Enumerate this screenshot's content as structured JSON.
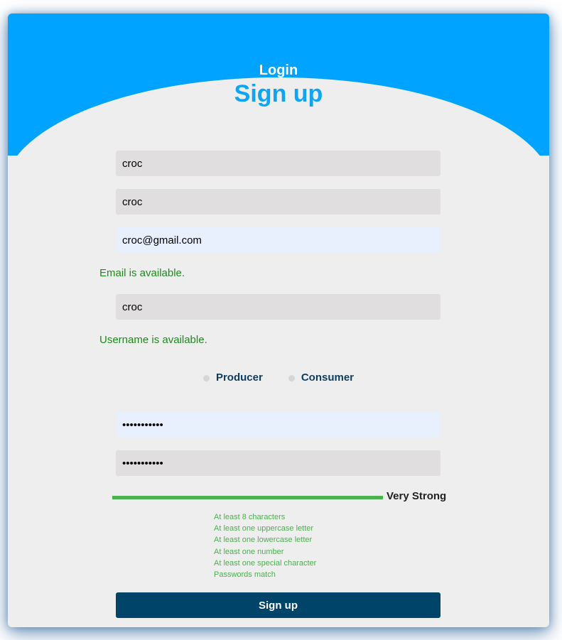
{
  "header": {
    "login_label": "Login",
    "title": "Sign up",
    "accent_color": "#00a3ff"
  },
  "form": {
    "first_name": "croc",
    "last_name": "croc",
    "email": "croc@gmail.com",
    "email_status": "Email is available.",
    "username": "croc",
    "username_status": "Username is available.",
    "roles": [
      {
        "label": "Producer",
        "selected": false
      },
      {
        "label": "Consumer",
        "selected": false
      }
    ],
    "password": "•••••••••••",
    "confirm_password": "•••••••••••"
  },
  "strength": {
    "level_fraction": 1.0,
    "label": "Very Strong",
    "color": "#4caf50"
  },
  "requirements": [
    "At least 8 characters",
    "At least one uppercase letter",
    "At least one lowercase letter",
    "At least one number",
    "At least one special character",
    "Passwords match"
  ],
  "submit_label": "Sign up",
  "submit_color": "#00446a"
}
